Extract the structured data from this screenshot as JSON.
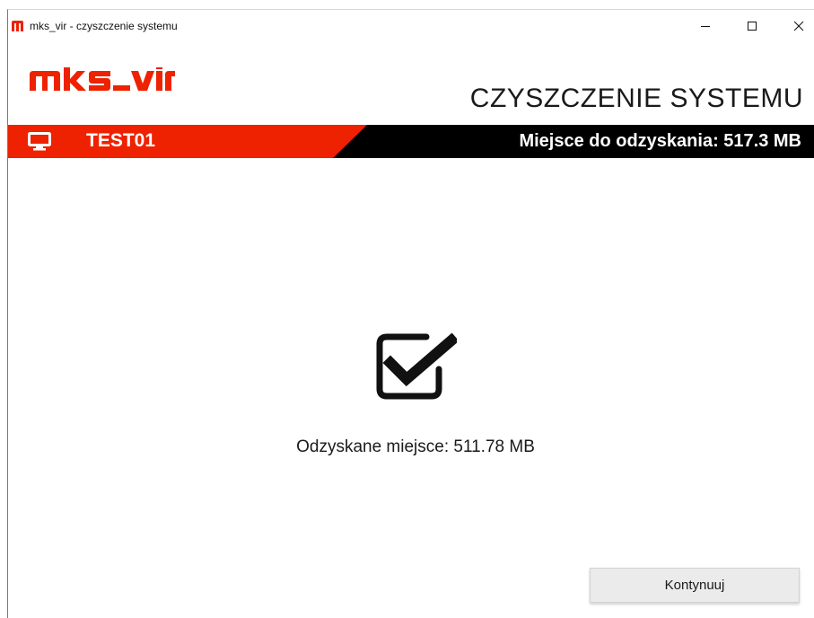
{
  "window": {
    "title": "mks_vir - czyszczenie systemu",
    "controls": {
      "minimize_icon": "minimize-icon",
      "maximize_icon": "maximize-icon",
      "close_icon": "close-icon"
    }
  },
  "header": {
    "logo_text": "mks_vir",
    "title": "CZYSZCZENIE SYSTEMU"
  },
  "banner": {
    "computer_icon": "monitor-icon",
    "computer_name": "TEST01",
    "recoverable_space": "Miejsce do odzyskania: 517.3 MB"
  },
  "main": {
    "status_icon": "checkbox-checked-icon",
    "recovered_space": "Odzyskane miejsce: 511.78 MB"
  },
  "footer": {
    "continue_label": "Kontynuuj"
  },
  "colors": {
    "brand_red": "#ee2200",
    "banner_black": "#000000",
    "text_dark": "#1a1a1a",
    "button_bg": "#ebebeb"
  }
}
